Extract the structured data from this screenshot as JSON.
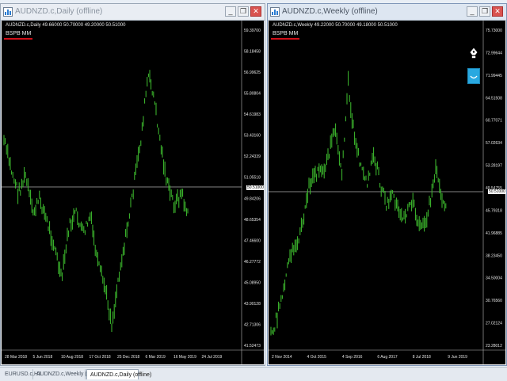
{
  "windows": [
    {
      "title": "AUDNZD.c,Daily (offline)",
      "legend": "AUDNZD.c,Daily  49.66000 50.70000 49.20000 50.51000",
      "indicator": "BSPB MM",
      "y_labels": [
        "59.39700",
        "58.18458",
        "56.99625",
        "55.80804",
        "54.61983",
        "53.43160",
        "52.24339",
        "51.05518",
        "49.84206",
        "48.65354",
        "47.46600",
        "46.27772",
        "45.08950",
        "43.90128",
        "42.71306",
        "41.52473"
      ],
      "x_labels": [
        "28 Mar 2018",
        "5 Jun 2018",
        "10 Aug 2018",
        "17 Oct 2018",
        "25 Dec 2018",
        "6 Mar 2019",
        "16 May 2019",
        "24 Jul 2019"
      ],
      "price_tag": "50.51000"
    },
    {
      "title": "AUDNZD.c,Weekly (offline)",
      "legend": "AUDNZD.c,Weekly  49.22000 50.70000 49.18000 50.51000",
      "indicator": "BSPB MM",
      "y_labels": [
        "75.73000",
        "72.99644",
        "71.99445",
        "64.51508",
        "60.77071",
        "57.02634",
        "53.28197",
        "49.54755",
        "45.79318",
        "41.96885",
        "38.23450",
        "34.50004",
        "30.76560",
        "27.02124",
        "23.28012"
      ],
      "x_labels": [
        "2 Nov 2014",
        "4 Oct 2015",
        "4 Sep 2016",
        "6 Aug 2017",
        "8 Jul 2018",
        "9 Jun 2019"
      ],
      "price_tag": "50.51000"
    }
  ],
  "tabs": [
    {
      "label": "EURUSD.c,H1",
      "active": false
    },
    {
      "label": "AUDNZD.c,Weekly (offline)",
      "active": false
    },
    {
      "label": "AUDNZD.c,Daily (offline)",
      "active": true
    }
  ],
  "window_buttons": {
    "minimize": "_",
    "restore": "❐",
    "close": "✕"
  },
  "colors": {
    "background": "#000000",
    "candles": "#3fbf2f",
    "price_line": "#b0b0b0",
    "underline": "#d0101a",
    "accent_button": "#29a8e0"
  }
}
